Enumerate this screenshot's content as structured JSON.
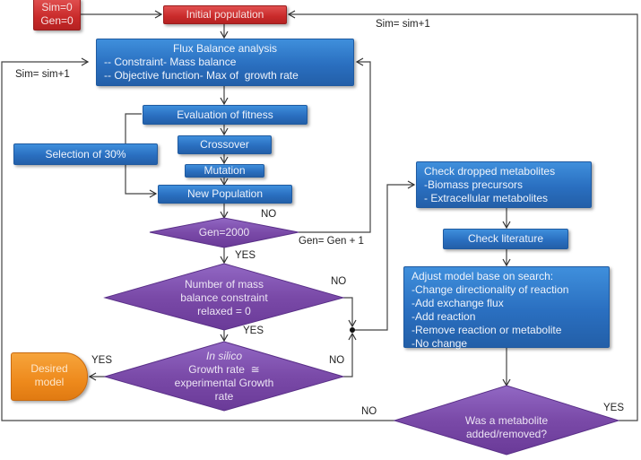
{
  "diagram": {
    "type": "flowchart",
    "nodes": {
      "start": {
        "lines": [
          "Sim=0",
          "Gen=0"
        ]
      },
      "initial_population": {
        "label": "Initial population"
      },
      "fba": {
        "title": "Flux Balance analysis",
        "lines": [
          "-- Constraint- Mass balance",
          "-- Objective function- Max of  growth rate"
        ]
      },
      "evaluation": {
        "label": "Evaluation of fitness"
      },
      "selection": {
        "label": "Selection of 30%"
      },
      "crossover": {
        "label": "Crossover"
      },
      "mutation": {
        "label": "Mutation"
      },
      "new_population": {
        "label": "New Population"
      },
      "gen_check": {
        "label": "Gen=2000"
      },
      "mass_balance_check": {
        "lines": [
          "Number of mass",
          "balance constraint",
          "relaxed = 0"
        ]
      },
      "growth_check": {
        "italic": "In silico",
        "lines": [
          "Growth rate  ≅",
          "experimental Growth",
          "rate"
        ]
      },
      "desired_model": {
        "lines": [
          "Desired",
          "model"
        ]
      },
      "check_dropped": {
        "lines": [
          "Check dropped metabolites",
          "-Biomass precursors",
          "- Extracellular metabolites"
        ]
      },
      "check_literature": {
        "label": "Check literature"
      },
      "adjust_model": {
        "lines": [
          "Adjust model base on search:",
          "-Change directionality of reaction",
          "-Add exchange flux",
          "-Add reaction",
          "-Remove reaction or metabolite",
          "-No change"
        ]
      },
      "metabolite_check": {
        "lines": [
          "Was a metabolite",
          "added/removed?"
        ]
      }
    },
    "edge_labels": {
      "sim_top": "Sim= sim+1",
      "sim_left": "Sim= sim+1",
      "gen_no": "NO",
      "gen_inc": "Gen= Gen + 1",
      "gen_yes": "YES",
      "mass_no": "NO",
      "mass_yes": "YES",
      "growth_yes": "YES",
      "growth_no": "NO",
      "metab_no": "NO",
      "metab_yes": "YES"
    },
    "colors": {
      "process": "#2a6fc0",
      "terminal_start": "#c92a2a",
      "decision": "#7a4aa8",
      "end": "#ee8a1c",
      "connector": "#444444"
    }
  }
}
